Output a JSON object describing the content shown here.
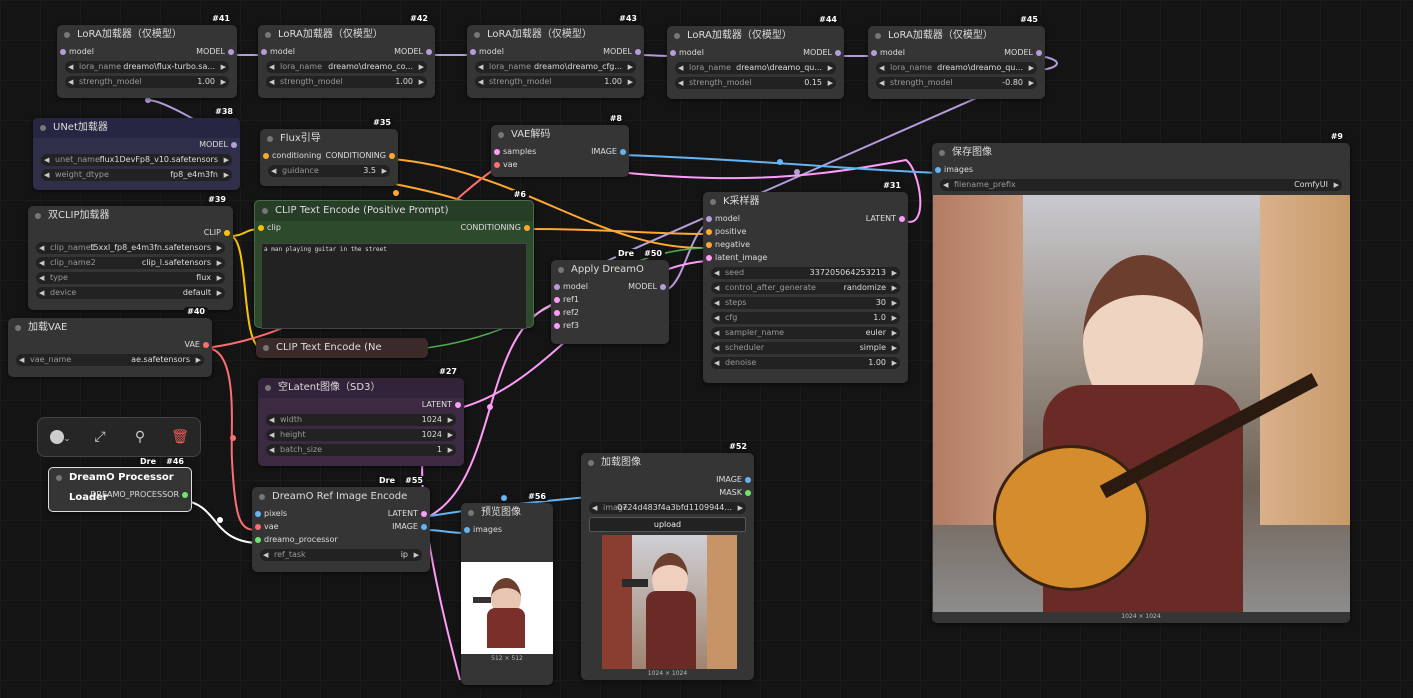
{
  "lora_nodes": [
    {
      "id": "#41",
      "title": "LoRA加载器（仅模型）",
      "in": "model",
      "out": "MODEL",
      "lora_name_label": "lora_name",
      "lora_name": "dreamo\\flux-turbo.sa...",
      "strength_label": "strength_model",
      "strength": "1.00"
    },
    {
      "id": "#42",
      "title": "LoRA加载器（仅模型）",
      "in": "model",
      "out": "MODEL",
      "lora_name_label": "lora_name",
      "lora_name": "dreamo\\dreamo_co...",
      "strength_label": "strength_model",
      "strength": "1.00"
    },
    {
      "id": "#43",
      "title": "LoRA加载器（仅模型）",
      "in": "model",
      "out": "MODEL",
      "lora_name_label": "lora_name",
      "lora_name": "dreamo\\dreamo_cfg...",
      "strength_label": "strength_model",
      "strength": "1.00"
    },
    {
      "id": "#44",
      "title": "LoRA加载器（仅模型）",
      "in": "model",
      "out": "MODEL",
      "lora_name_label": "lora_name",
      "lora_name": "dreamo\\dreamo_qu...",
      "strength_label": "strength_model",
      "strength": "0.15"
    },
    {
      "id": "#45",
      "title": "LoRA加载器（仅模型）",
      "in": "model",
      "out": "MODEL",
      "lora_name_label": "lora_name",
      "lora_name": "dreamo\\dreamo_qu...",
      "strength_label": "strength_model",
      "strength": "-0.80"
    }
  ],
  "unet": {
    "id": "#38",
    "title": "UNet加载器",
    "out": "MODEL",
    "w1l": "unet_name",
    "w1v": "flux1DevFp8_v10.safetensors",
    "w2l": "weight_dtype",
    "w2v": "fp8_e4m3fn"
  },
  "flux": {
    "id": "#35",
    "title": "Flux引导",
    "in": "conditioning",
    "out": "CONDITIONING",
    "wl": "guidance",
    "wv": "3.5"
  },
  "vaedecode": {
    "id": "#8",
    "title": "VAE解码",
    "in1": "samples",
    "in2": "vae",
    "out": "IMAGE"
  },
  "save": {
    "id": "#9",
    "title": "保存图像",
    "in": "images",
    "wl": "filename_prefix",
    "wv": "ComfyUI",
    "size": "1024 × 1024"
  },
  "dualclip": {
    "id": "#39",
    "title": "双CLIP加载器",
    "out": "CLIP",
    "w": [
      [
        "clip_name1",
        "t5xxl_fp8_e4m3fn.safetensors"
      ],
      [
        "clip_name2",
        "clip_l.safetensors"
      ],
      [
        "type",
        "flux"
      ],
      [
        "device",
        "default"
      ]
    ]
  },
  "clippos": {
    "id": "#6",
    "title": "CLIP Text Encode (Positive Prompt)",
    "in": "clip",
    "out": "CONDITIONING",
    "text": "a man playing guitar in the street"
  },
  "ksampler": {
    "id": "#31",
    "title": "K采样器",
    "in": [
      "model",
      "positive",
      "negative",
      "latent_image"
    ],
    "out": "LATENT",
    "w": [
      [
        "seed",
        "337205064253213"
      ],
      [
        "control_after_generate",
        "randomize"
      ],
      [
        "steps",
        "30"
      ],
      [
        "cfg",
        "1.0"
      ],
      [
        "sampler_name",
        "euler"
      ],
      [
        "scheduler",
        "simple"
      ],
      [
        "denoise",
        "1.00"
      ]
    ]
  },
  "applydreamo": {
    "id": "#50",
    "tag": "Dre",
    "title": "Apply DreamO",
    "in": [
      "model",
      "ref1",
      "ref2",
      "ref3"
    ],
    "out": "MODEL"
  },
  "vaeload": {
    "id": "#40",
    "title": "加载VAE",
    "out": "VAE",
    "wl": "vae_name",
    "wv": "ae.safetensors"
  },
  "clipneg": {
    "title": "CLIP Text Encode (Ne"
  },
  "latent": {
    "id": "#27",
    "title": "空Latent图像（SD3）",
    "out": "LATENT",
    "w": [
      [
        "width",
        "1024"
      ],
      [
        "height",
        "1024"
      ],
      [
        "batch_size",
        "1"
      ]
    ]
  },
  "processor": {
    "id": "#46",
    "tag": "Dre",
    "title": "DreamO Processor Loader",
    "out": "DREAMO_PROCESSOR"
  },
  "refenc": {
    "id": "#55",
    "tag": "Dre",
    "title": "DreamO Ref Image Encode",
    "in": [
      "pixels",
      "vae",
      "dreamo_processor"
    ],
    "out": [
      "LATENT",
      "IMAGE"
    ],
    "wl": "ref_task",
    "wv": "ip"
  },
  "preview": {
    "id": "#56",
    "title": "预览图像",
    "in": "images",
    "size": "512 × 512"
  },
  "loadimg": {
    "id": "#52",
    "title": "加载图像",
    "out": [
      "IMAGE",
      "MASK"
    ],
    "wl": "image",
    "wv": "0724d483f4a3bfd1109944...",
    "upload": "upload",
    "size": "1024 × 1024"
  },
  "colors": {
    "model": "#b39ddb",
    "clip": "#f6c700",
    "cond": "#ffa931",
    "vae": "#ff6e6e",
    "latent": "#ff9cf9",
    "image": "#64b5f6",
    "processor": "#ffffff"
  }
}
